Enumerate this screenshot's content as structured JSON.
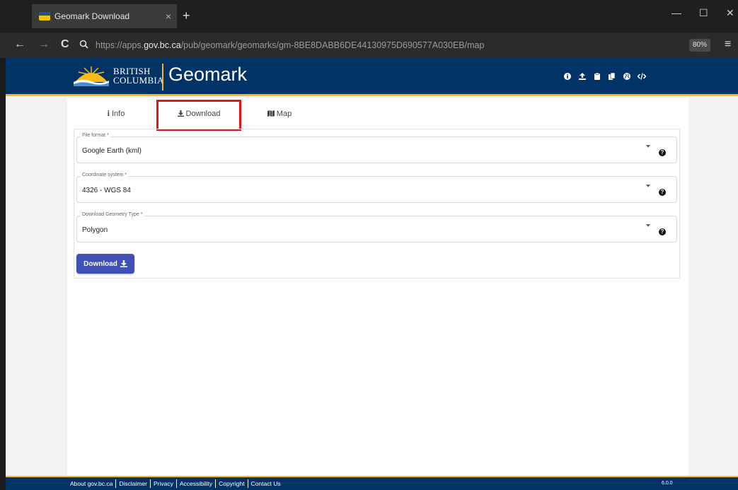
{
  "browser": {
    "tab_title": "Geomark Download",
    "tab_close": "×",
    "new_tab": "+",
    "back": "←",
    "forward": "→",
    "reload": "C",
    "url_prefix": "https://apps.",
    "url_domain": "gov.bc.ca",
    "url_path": "/pub/geomark/geomarks/gm-8BE8DABB6DE44130975D690577A030EB/map",
    "zoom": "80%",
    "minimize": "—",
    "restore": "☐",
    "close": "✕",
    "menu": "≡"
  },
  "header": {
    "org_line1": "BRITISH",
    "org_line2": "COLUMBIA",
    "app_title": "Geomark",
    "icons": [
      "info-circle-icon",
      "upload-icon",
      "clipboard-icon",
      "copy-icon",
      "globe-icon",
      "code-icon"
    ]
  },
  "tabs": [
    {
      "label": "Info",
      "icon": "info-icon"
    },
    {
      "label": "Download",
      "icon": "download-icon"
    },
    {
      "label": "Map",
      "icon": "map-icon"
    }
  ],
  "form": {
    "file_format": {
      "label": "File format *",
      "value": "Google Earth (kml)"
    },
    "coordinate_system": {
      "label": "Coordinate system *",
      "value": "4326 - WGS 84"
    },
    "geometry_type": {
      "label": "Download Geometry Type *",
      "value": "Polygon"
    },
    "download_button": "Download"
  },
  "footer": {
    "links": [
      "About gov.bc.ca",
      "Disclaimer",
      "Privacy",
      "Accessibility",
      "Copyright",
      "Contact Us"
    ],
    "version": "6.0.0"
  },
  "colors": {
    "header_bg": "#013366",
    "accent_gold": "#fcba19",
    "button_blue": "#3f51b5",
    "highlight_red": "#e8131a"
  }
}
